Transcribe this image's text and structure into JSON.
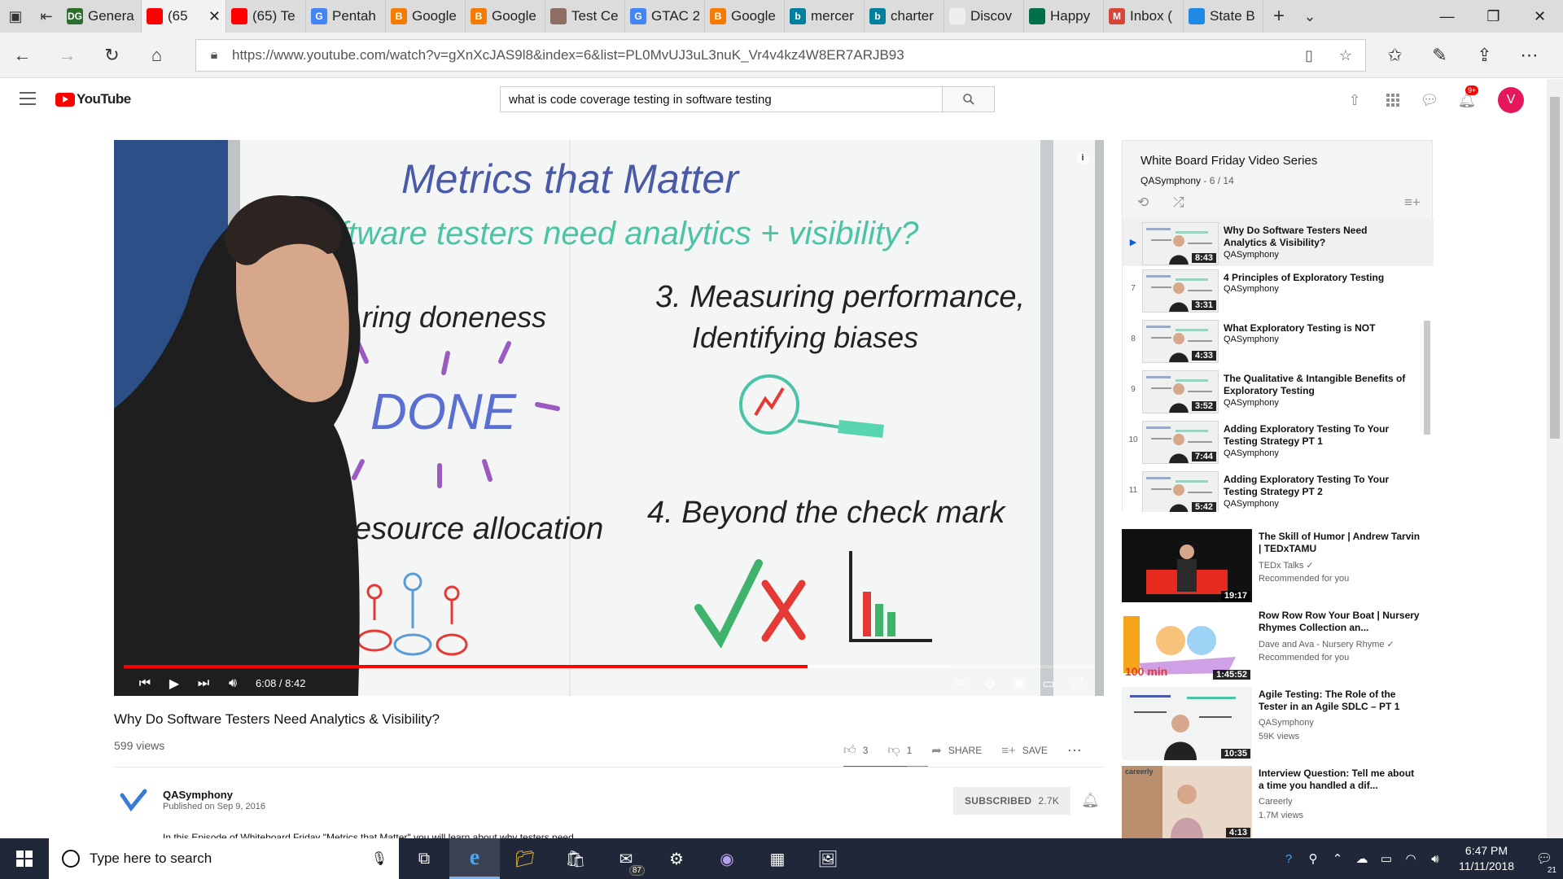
{
  "browser": {
    "tabs": [
      {
        "label": "Genera",
        "fav": "#2c6e2c",
        "fav_text": "DG"
      },
      {
        "label": "(65",
        "fav": "#f00",
        "active": true
      },
      {
        "label": "(65) Te",
        "fav": "#f00"
      },
      {
        "label": "Pentah",
        "fav": "#4285f4",
        "fav_text": "G"
      },
      {
        "label": "Google",
        "fav": "#f57c00",
        "fav_text": "B"
      },
      {
        "label": "Google",
        "fav": "#f57c00",
        "fav_text": "B"
      },
      {
        "label": "Test Ce",
        "fav": "#8d6e63"
      },
      {
        "label": "GTAC 2",
        "fav": "#4285f4",
        "fav_text": "G"
      },
      {
        "label": "Google",
        "fav": "#f57c00",
        "fav_text": "B"
      },
      {
        "label": "mercer",
        "fav": "#00809d",
        "fav_text": "b"
      },
      {
        "label": "charter",
        "fav": "#00809d",
        "fav_text": "b"
      },
      {
        "label": "Discov",
        "fav": "#eeeeee"
      },
      {
        "label": "Happy",
        "fav": "#00704a"
      },
      {
        "label": "Inbox (",
        "fav": "#d44638",
        "fav_text": "M"
      },
      {
        "label": "State B",
        "fav": "#1e88e5"
      }
    ],
    "url": "https://www.youtube.com/watch?v=gXnXcJAS9l8&index=6&list=PL0MvUJ3uL3nuK_Vr4v4kz4W8ER7ARJB93"
  },
  "youtube": {
    "logo_text": "YouTube",
    "search_value": "what is code coverage testing in software testing",
    "notifications_badge": "9+",
    "avatar_letter": "V"
  },
  "player": {
    "time_current": "6:08",
    "time_total": "8:42",
    "time_display": "6:08 / 8:42",
    "played_fraction": 0.705,
    "loaded_fraction": 0.855
  },
  "whiteboard": {
    "title": "Metrics that Matter",
    "subtitle": "Do software testers need analytics + visibility?",
    "item1": "ring doneness",
    "done": "DONE",
    "item2": "esource allocation",
    "item3_line1": "3. Measuring performance,",
    "item3_line2": "Identifying biases",
    "item4": "4. Beyond the check mark"
  },
  "video": {
    "title": "Why Do Software Testers Need Analytics & Visibility?",
    "views": "599 views",
    "likes": "3",
    "dislikes": "1",
    "share_label": "SHARE",
    "save_label": "SAVE",
    "channel": "QASymphony",
    "published": "Published on Sep 9, 2016",
    "subscribed_label": "SUBSCRIBED",
    "subscriber_count": "2.7K",
    "description": "In this Episode of Whiteboard Friday \"Metrics that Matter\" you will learn about why testers need"
  },
  "playlist": {
    "title": "White Board Friday Video Series",
    "channel": "QASymphony",
    "position": "- 6 / 14",
    "items": [
      {
        "index": "",
        "title": "Why Do Software Testers Need Analytics & Visibility?",
        "channel": "QASymphony",
        "duration": "8:43",
        "current": true
      },
      {
        "index": "7",
        "title": "4 Principles of Exploratory Testing",
        "channel": "QASymphony",
        "duration": "3:31"
      },
      {
        "index": "8",
        "title": "What Exploratory Testing is NOT",
        "channel": "QASymphony",
        "duration": "4:33"
      },
      {
        "index": "9",
        "title": "The Qualitative & Intangible Benefits of Exploratory Testing",
        "channel": "QASymphony",
        "duration": "3:52"
      },
      {
        "index": "10",
        "title": "Adding Exploratory Testing To Your Testing Strategy PT 1",
        "channel": "QASymphony",
        "duration": "7:44"
      },
      {
        "index": "11",
        "title": "Adding Exploratory Testing To Your Testing Strategy PT 2",
        "channel": "QASymphony",
        "duration": "5:42"
      }
    ]
  },
  "recommendations": [
    {
      "title": "The Skill of Humor | Andrew Tarvin | TEDxTAMU",
      "channel": "TEDx Talks ✓",
      "meta": "Recommended for you",
      "duration": "19:17",
      "thumb": "ted"
    },
    {
      "title": "Row Row Row Your Boat | Nursery Rhymes Collection an...",
      "channel": "Dave and Ava - Nursery Rhyme ✓",
      "meta": "Recommended for you",
      "duration": "1:45:52",
      "thumb_text": "100 min",
      "thumb": "kids"
    },
    {
      "title": "Agile Testing: The Role of the Tester in an Agile SDLC – PT 1",
      "channel": "QASymphony",
      "meta": "59K views",
      "duration": "10:35",
      "thumb": "board"
    },
    {
      "title": "Interview Question: Tell me about a time you handled a dif...",
      "channel": "Careerly",
      "meta": "1.7M views",
      "duration": "4:13",
      "thumb_text": "careerly",
      "thumb": "person"
    }
  ],
  "taskbar": {
    "search_placeholder": "Type here to search",
    "mail_badge": "87",
    "time": "6:47 PM",
    "date": "11/11/2018",
    "notif_count": "21"
  }
}
